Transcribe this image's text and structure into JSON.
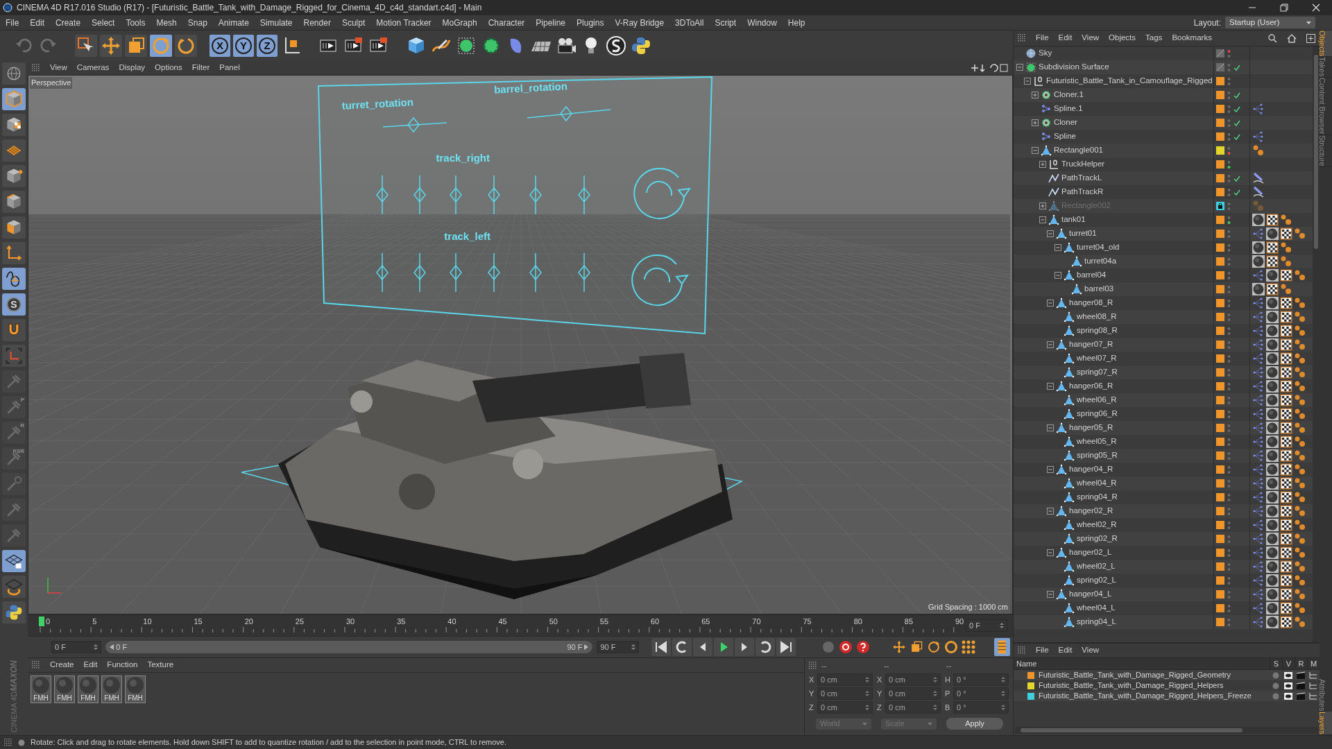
{
  "window": {
    "title": "CINEMA 4D R17.016 Studio (R17) - [Futuristic_Battle_Tank_with_Damage_Rigged_for_Cinema_4D_c4d_standart.c4d] - Main"
  },
  "menu_bar": [
    "File",
    "Edit",
    "Create",
    "Select",
    "Tools",
    "Mesh",
    "Snap",
    "Animate",
    "Simulate",
    "Render",
    "Sculpt",
    "Motion Tracker",
    "MoGraph",
    "Character",
    "Pipeline",
    "Plugins",
    "V-Ray Bridge",
    "3DToAll",
    "Script",
    "Window",
    "Help"
  ],
  "layout": {
    "label": "Layout:",
    "value": "Startup (User)"
  },
  "toolbar": {
    "tools": [
      {
        "kind": "select",
        "selected": false
      },
      {
        "kind": "move",
        "selected": false
      },
      {
        "kind": "scale",
        "selected": false
      },
      {
        "kind": "rotate",
        "selected": true
      },
      {
        "kind": "recent",
        "selected": false
      }
    ],
    "axes": [
      {
        "label": "X",
        "selected": true
      },
      {
        "label": "Y",
        "selected": true
      },
      {
        "label": "Z",
        "selected": true
      }
    ]
  },
  "mode_palette": [
    {
      "kind": "globe",
      "selected": false,
      "disabled": false
    },
    {
      "kind": "model",
      "selected": true,
      "disabled": false
    },
    {
      "kind": "texture",
      "selected": false,
      "disabled": false
    },
    {
      "kind": "grid",
      "selected": false,
      "disabled": false
    },
    {
      "kind": "points",
      "selected": false,
      "disabled": false
    },
    {
      "kind": "edges",
      "selected": false,
      "disabled": false
    },
    {
      "kind": "polygons",
      "selected": false,
      "disabled": false
    },
    {
      "kind": "axis",
      "selected": false,
      "disabled": false
    },
    {
      "kind": "tweak",
      "selected": true,
      "disabled": false
    },
    {
      "kind": "solo",
      "label": "S",
      "selected": true,
      "disabled": false
    },
    {
      "kind": "magnet",
      "selected": false,
      "disabled": false
    },
    {
      "kind": "frame",
      "selected": false,
      "disabled": false
    },
    {
      "kind": "pin",
      "selected": false,
      "disabled": true
    },
    {
      "kind": "pin",
      "label": "P",
      "selected": false,
      "disabled": true
    },
    {
      "kind": "pin",
      "label": "R",
      "selected": false,
      "disabled": true
    },
    {
      "kind": "pin",
      "label": "PSR",
      "selected": false,
      "disabled": true
    },
    {
      "kind": "target",
      "selected": false,
      "disabled": true
    },
    {
      "kind": "pin",
      "selected": false,
      "disabled": true
    },
    {
      "kind": "pin",
      "selected": false,
      "disabled": true
    },
    {
      "kind": "lock",
      "selected": true,
      "disabled": false
    },
    {
      "kind": "planerotate",
      "selected": false,
      "disabled": false
    },
    {
      "kind": "python",
      "selected": false,
      "disabled": false
    }
  ],
  "logo": {
    "brand": "MAXON",
    "product": "CINEMA 4D"
  },
  "viewport": {
    "menu": [
      "View",
      "Cameras",
      "Display",
      "Options",
      "Filter",
      "Panel"
    ],
    "camera": "Perspective",
    "grid_spacing": "Grid Spacing : 1000 cm",
    "control_labels": [
      "turret_rotation",
      "barrel_rotation",
      "track_right",
      "track_left"
    ]
  },
  "timeline": {
    "ticks": [
      "0",
      "5",
      "10",
      "15",
      "20",
      "25",
      "30",
      "35",
      "40",
      "45",
      "50",
      "55",
      "60",
      "65",
      "70",
      "75",
      "80",
      "85",
      "90"
    ],
    "frame_display": "0 F",
    "current_frame": "0 F",
    "range_start": "0 F",
    "range_end": "90 F",
    "level": 1,
    "end_frame": "90 F"
  },
  "materials": {
    "menu": [
      "Create",
      "Edit",
      "Function",
      "Texture"
    ],
    "items": [
      {
        "label": "FMH"
      },
      {
        "label": "FMH"
      },
      {
        "label": "FMH"
      },
      {
        "label": "FMH"
      },
      {
        "label": "FMH"
      }
    ]
  },
  "coordinates": {
    "headers": [
      "--",
      "--",
      "--"
    ],
    "rows": [
      {
        "axis": "X",
        "value": "0 cm",
        "axis_2": "X",
        "value_2": "0 cm",
        "axis_3": "H",
        "value_3": "0 °"
      },
      {
        "axis": "Y",
        "value": "0 cm",
        "axis_2": "Y",
        "value_2": "0 cm",
        "axis_3": "P",
        "value_3": "0 °"
      },
      {
        "axis": "Z",
        "value": "0 cm",
        "axis_2": "Z",
        "value_2": "0 cm",
        "axis_3": "B",
        "value_3": "0 °"
      }
    ],
    "dropdowns": [
      "World",
      "Scale"
    ],
    "apply": "Apply"
  },
  "object_manager": {
    "menu": [
      "File",
      "Edit",
      "View",
      "Objects",
      "Tags",
      "Bookmarks"
    ],
    "objects": [
      {
        "name": "Sky",
        "kind": "sky",
        "checked": false,
        "hidden_in_editor": true
      },
      {
        "name": "Subdivision Surface",
        "kind": "subdivision",
        "checked": true,
        "expanded": true,
        "children": [
          {
            "name": "Futuristic_Battle_Tank_in_Camouflage_Rigged",
            "kind": "null",
            "color": "#f0952a",
            "checked": false,
            "expanded": true,
            "children": [
              {
                "name": "Cloner.1",
                "kind": "cloner",
                "color": "#f0952a",
                "checked": true,
                "expanded": false
              },
              {
                "name": "Spline.1",
                "kind": "spline",
                "color": "#f0952a",
                "checked": true,
                "tags": [
                  {
                    "kind": "branch"
                  }
                ]
              },
              {
                "name": "Cloner",
                "kind": "cloner",
                "color": "#f0952a",
                "checked": true,
                "expanded": false
              },
              {
                "name": "Spline",
                "kind": "spline",
                "color": "#f0952a",
                "checked": true,
                "tags": [
                  {
                    "kind": "branch"
                  }
                ]
              },
              {
                "name": "Rectangle001",
                "kind": "polygon",
                "color": "#e2d52c",
                "checked": false,
                "hidden_in_render": true,
                "expanded": true,
                "tags": [
                  {
                    "kind": "dots"
                  }
                ],
                "children": [
                  {
                    "name": "TruckHelper",
                    "kind": "null",
                    "color": "#f0952a",
                    "checked": false,
                    "shown_in_render": true,
                    "expanded": false
                  },
                  {
                    "name": "PathTrackL",
                    "kind": "path",
                    "color": "#f0952a",
                    "checked": true,
                    "tags": [
                      {
                        "kind": "brush"
                      }
                    ]
                  },
                  {
                    "name": "PathTrackR",
                    "kind": "path",
                    "color": "#f0952a",
                    "checked": true,
                    "tags": [
                      {
                        "kind": "brush"
                      }
                    ]
                  },
                  {
                    "name": "Rectangle002",
                    "kind": "polygon",
                    "color": "#3fd0e0",
                    "locked": true,
                    "disabled": true,
                    "checked": false,
                    "expanded": false,
                    "tags": [
                      {
                        "kind": "dots"
                      }
                    ]
                  },
                  {
                    "name": "tank01",
                    "kind": "polygon",
                    "color": "#f0952a",
                    "checked": false,
                    "shown_in_render": true,
                    "expanded": true,
                    "tags": [
                      {
                        "kind": "material"
                      },
                      {
                        "kind": "texture"
                      },
                      {
                        "kind": "dots"
                      }
                    ],
                    "children": [
                      {
                        "name": "turret01",
                        "kind": "polygon",
                        "color": "#f0952a",
                        "checked": false,
                        "expanded": true,
                        "tags": [
                          {
                            "kind": "branch"
                          },
                          {
                            "kind": "material"
                          },
                          {
                            "kind": "texture"
                          },
                          {
                            "kind": "dots"
                          }
                        ],
                        "children": [
                          {
                            "name": "turret04_old",
                            "kind": "polygon",
                            "color": "#f0952a",
                            "checked": false,
                            "expanded": true,
                            "tags": [
                              {
                                "kind": "material"
                              },
                              {
                                "kind": "texture"
                              },
                              {
                                "kind": "dots"
                              }
                            ],
                            "children": [
                              {
                                "name": "turret04a",
                                "kind": "polygon",
                                "color": "#f0952a",
                                "checked": false,
                                "tags": [
                                  {
                                    "kind": "material"
                                  },
                                  {
                                    "kind": "texture"
                                  },
                                  {
                                    "kind": "dots"
                                  }
                                ]
                              }
                            ]
                          },
                          {
                            "name": "barrel04",
                            "kind": "polygon",
                            "color": "#f0952a",
                            "checked": false,
                            "expanded": true,
                            "tags": [
                              {
                                "kind": "branch"
                              },
                              {
                                "kind": "material"
                              },
                              {
                                "kind": "texture"
                              },
                              {
                                "kind": "dots"
                              }
                            ],
                            "children": [
                              {
                                "name": "barrel03",
                                "kind": "polygon",
                                "color": "#f0952a",
                                "checked": false,
                                "tags": [
                                  {
                                    "kind": "material"
                                  },
                                  {
                                    "kind": "texture"
                                  },
                                  {
                                    "kind": "dots"
                                  }
                                ]
                              }
                            ]
                          }
                        ]
                      },
                      {
                        "name": "hanger08_R",
                        "kind": "polygon",
                        "color": "#f0952a",
                        "checked": false,
                        "expanded": true,
                        "tags": [
                          {
                            "kind": "branch"
                          },
                          {
                            "kind": "material"
                          },
                          {
                            "kind": "texture"
                          },
                          {
                            "kind": "dots"
                          }
                        ],
                        "children": [
                          {
                            "name": "wheel08_R",
                            "kind": "polygon",
                            "color": "#f0952a",
                            "checked": false,
                            "tags": [
                              {
                                "kind": "branch"
                              },
                              {
                                "kind": "material"
                              },
                              {
                                "kind": "texture"
                              },
                              {
                                "kind": "dots"
                              }
                            ]
                          },
                          {
                            "name": "spring08_R",
                            "kind": "polygon",
                            "color": "#f0952a",
                            "checked": false,
                            "tags": [
                              {
                                "kind": "branch"
                              },
                              {
                                "kind": "material"
                              },
                              {
                                "kind": "texture"
                              },
                              {
                                "kind": "dots"
                              }
                            ]
                          }
                        ]
                      },
                      {
                        "name": "hanger07_R",
                        "kind": "polygon",
                        "color": "#f0952a",
                        "checked": false,
                        "expanded": true,
                        "tags": [
                          {
                            "kind": "branch"
                          },
                          {
                            "kind": "material"
                          },
                          {
                            "kind": "texture"
                          },
                          {
                            "kind": "dots"
                          }
                        ],
                        "children": [
                          {
                            "name": "wheel07_R",
                            "kind": "polygon",
                            "color": "#f0952a",
                            "checked": false,
                            "tags": [
                              {
                                "kind": "branch"
                              },
                              {
                                "kind": "material"
                              },
                              {
                                "kind": "texture"
                              },
                              {
                                "kind": "dots"
                              }
                            ]
                          },
                          {
                            "name": "spring07_R",
                            "kind": "polygon",
                            "color": "#f0952a",
                            "checked": false,
                            "tags": [
                              {
                                "kind": "branch"
                              },
                              {
                                "kind": "material"
                              },
                              {
                                "kind": "texture"
                              },
                              {
                                "kind": "dots"
                              }
                            ]
                          }
                        ]
                      },
                      {
                        "name": "hanger06_R",
                        "kind": "polygon",
                        "color": "#f0952a",
                        "checked": false,
                        "expanded": true,
                        "tags": [
                          {
                            "kind": "branch"
                          },
                          {
                            "kind": "material"
                          },
                          {
                            "kind": "texture"
                          },
                          {
                            "kind": "dots"
                          }
                        ],
                        "children": [
                          {
                            "name": "wheel06_R",
                            "kind": "polygon",
                            "color": "#f0952a",
                            "checked": false,
                            "tags": [
                              {
                                "kind": "branch"
                              },
                              {
                                "kind": "material"
                              },
                              {
                                "kind": "texture"
                              },
                              {
                                "kind": "dots"
                              }
                            ]
                          },
                          {
                            "name": "spring06_R",
                            "kind": "polygon",
                            "color": "#f0952a",
                            "checked": false,
                            "tags": [
                              {
                                "kind": "branch"
                              },
                              {
                                "kind": "material"
                              },
                              {
                                "kind": "texture"
                              },
                              {
                                "kind": "dots"
                              }
                            ]
                          }
                        ]
                      },
                      {
                        "name": "hanger05_R",
                        "kind": "polygon",
                        "color": "#f0952a",
                        "checked": false,
                        "expanded": true,
                        "tags": [
                          {
                            "kind": "branch"
                          },
                          {
                            "kind": "material"
                          },
                          {
                            "kind": "texture"
                          },
                          {
                            "kind": "dots"
                          }
                        ],
                        "children": [
                          {
                            "name": "wheel05_R",
                            "kind": "polygon",
                            "color": "#f0952a",
                            "checked": false,
                            "tags": [
                              {
                                "kind": "branch"
                              },
                              {
                                "kind": "material"
                              },
                              {
                                "kind": "texture"
                              },
                              {
                                "kind": "dots"
                              }
                            ]
                          },
                          {
                            "name": "spring05_R",
                            "kind": "polygon",
                            "color": "#f0952a",
                            "checked": false,
                            "tags": [
                              {
                                "kind": "branch"
                              },
                              {
                                "kind": "material"
                              },
                              {
                                "kind": "texture"
                              },
                              {
                                "kind": "dots"
                              }
                            ]
                          }
                        ]
                      },
                      {
                        "name": "hanger04_R",
                        "kind": "polygon",
                        "color": "#f0952a",
                        "checked": false,
                        "expanded": true,
                        "tags": [
                          {
                            "kind": "branch"
                          },
                          {
                            "kind": "material"
                          },
                          {
                            "kind": "texture"
                          },
                          {
                            "kind": "dots"
                          }
                        ],
                        "children": [
                          {
                            "name": "wheel04_R",
                            "kind": "polygon",
                            "color": "#f0952a",
                            "checked": false,
                            "tags": [
                              {
                                "kind": "branch"
                              },
                              {
                                "kind": "material"
                              },
                              {
                                "kind": "texture"
                              },
                              {
                                "kind": "dots"
                              }
                            ]
                          },
                          {
                            "name": "spring04_R",
                            "kind": "polygon",
                            "color": "#f0952a",
                            "checked": false,
                            "tags": [
                              {
                                "kind": "branch"
                              },
                              {
                                "kind": "material"
                              },
                              {
                                "kind": "texture"
                              },
                              {
                                "kind": "dots"
                              }
                            ]
                          }
                        ]
                      },
                      {
                        "name": "hanger02_R",
                        "kind": "polygon",
                        "color": "#f0952a",
                        "checked": false,
                        "expanded": true,
                        "tags": [
                          {
                            "kind": "branch"
                          },
                          {
                            "kind": "material"
                          },
                          {
                            "kind": "texture"
                          },
                          {
                            "kind": "dots"
                          }
                        ],
                        "children": [
                          {
                            "name": "wheel02_R",
                            "kind": "polygon",
                            "color": "#f0952a",
                            "checked": false,
                            "tags": [
                              {
                                "kind": "branch"
                              },
                              {
                                "kind": "material"
                              },
                              {
                                "kind": "texture"
                              },
                              {
                                "kind": "dots"
                              }
                            ]
                          },
                          {
                            "name": "spring02_R",
                            "kind": "polygon",
                            "color": "#f0952a",
                            "checked": false,
                            "tags": [
                              {
                                "kind": "branch"
                              },
                              {
                                "kind": "material"
                              },
                              {
                                "kind": "texture"
                              },
                              {
                                "kind": "dots"
                              }
                            ]
                          }
                        ]
                      },
                      {
                        "name": "hanger02_L",
                        "kind": "polygon",
                        "color": "#f0952a",
                        "checked": false,
                        "expanded": true,
                        "tags": [
                          {
                            "kind": "branch"
                          },
                          {
                            "kind": "material"
                          },
                          {
                            "kind": "texture"
                          },
                          {
                            "kind": "dots"
                          }
                        ],
                        "children": [
                          {
                            "name": "wheel02_L",
                            "kind": "polygon",
                            "color": "#f0952a",
                            "checked": false,
                            "tags": [
                              {
                                "kind": "branch"
                              },
                              {
                                "kind": "material"
                              },
                              {
                                "kind": "texture"
                              },
                              {
                                "kind": "dots"
                              }
                            ]
                          },
                          {
                            "name": "spring02_L",
                            "kind": "polygon",
                            "color": "#f0952a",
                            "checked": false,
                            "tags": [
                              {
                                "kind": "branch"
                              },
                              {
                                "kind": "material"
                              },
                              {
                                "kind": "texture"
                              },
                              {
                                "kind": "dots"
                              }
                            ]
                          }
                        ]
                      },
                      {
                        "name": "hanger04_L",
                        "kind": "polygon",
                        "color": "#f0952a",
                        "checked": false,
                        "expanded": true,
                        "tags": [
                          {
                            "kind": "branch"
                          },
                          {
                            "kind": "material"
                          },
                          {
                            "kind": "texture"
                          },
                          {
                            "kind": "dots"
                          }
                        ],
                        "children": [
                          {
                            "name": "wheel04_L",
                            "kind": "polygon",
                            "color": "#f0952a",
                            "checked": false,
                            "tags": [
                              {
                                "kind": "branch"
                              },
                              {
                                "kind": "material"
                              },
                              {
                                "kind": "texture"
                              },
                              {
                                "kind": "dots"
                              }
                            ]
                          },
                          {
                            "name": "spring04_L",
                            "kind": "polygon",
                            "color": "#f0952a",
                            "checked": false,
                            "tags": [
                              {
                                "kind": "branch"
                              },
                              {
                                "kind": "material"
                              },
                              {
                                "kind": "texture"
                              },
                              {
                                "kind": "dots"
                              }
                            ]
                          }
                        ]
                      }
                    ]
                  }
                ]
              }
            ]
          }
        ]
      }
    ]
  },
  "layers": {
    "menu": [
      "File",
      "Edit",
      "View"
    ],
    "columns": [
      "Name",
      "S",
      "V",
      "R",
      "M"
    ],
    "items": [
      {
        "name": "Futuristic_Battle_Tank_with_Damage_Rigged_Geometry",
        "color": "#f0952a"
      },
      {
        "name": "Futuristic_Battle_Tank_with_Damage_Rigged_Helpers",
        "color": "#e2d52c"
      },
      {
        "name": "Futuristic_Battle_Tank_with_Damage_Rigged_Helpers_Freeze",
        "color": "#3fd0e0"
      }
    ]
  },
  "side_tabs": {
    "top": [
      {
        "label": "Objects",
        "selected": true
      },
      {
        "label": "Takes",
        "selected": false
      },
      {
        "label": "Content Browser",
        "selected": false
      },
      {
        "label": "Structure",
        "selected": false
      }
    ],
    "bottom": [
      {
        "label": "Attributes",
        "selected": false
      },
      {
        "label": "Layers",
        "selected": true
      }
    ]
  },
  "status_bar": {
    "text": "Rotate: Click and drag to rotate elements. Hold down SHIFT to add to quantize rotation / add to the selection in point mode, CTRL to remove."
  }
}
